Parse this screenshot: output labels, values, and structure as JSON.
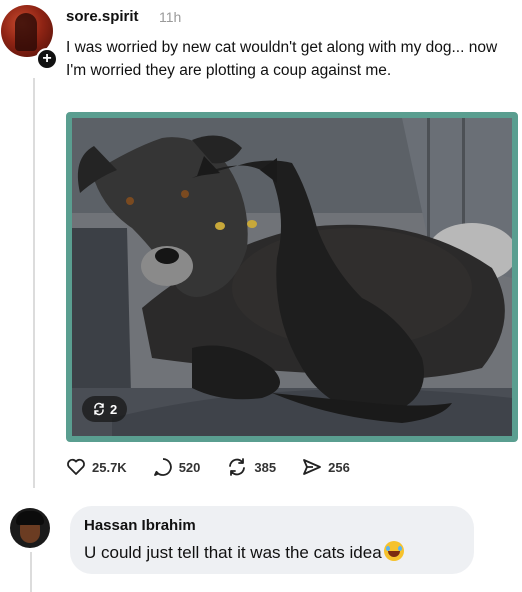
{
  "post": {
    "username": "sore.spirit",
    "timestamp": "11h",
    "text": "I was worried by new cat wouldn't get along with my dog... now I'm worried they are plotting a coup against me.",
    "follow_badge": "+",
    "media": {
      "repost_count": "2"
    },
    "actions": {
      "likes": "25.7K",
      "replies": "520",
      "reposts": "385",
      "shares": "256"
    }
  },
  "comment": {
    "author": "Hassan Ibrahim",
    "text": "U could just tell that it was the cats idea"
  },
  "colors": {
    "media_border": "#5a9e90",
    "bubble_bg": "#eef0f3",
    "muted_text": "#9a9a9a"
  },
  "icons": [
    "heart-icon",
    "reply-icon",
    "repost-icon",
    "share-icon",
    "plus-icon",
    "laughing-emoji"
  ]
}
